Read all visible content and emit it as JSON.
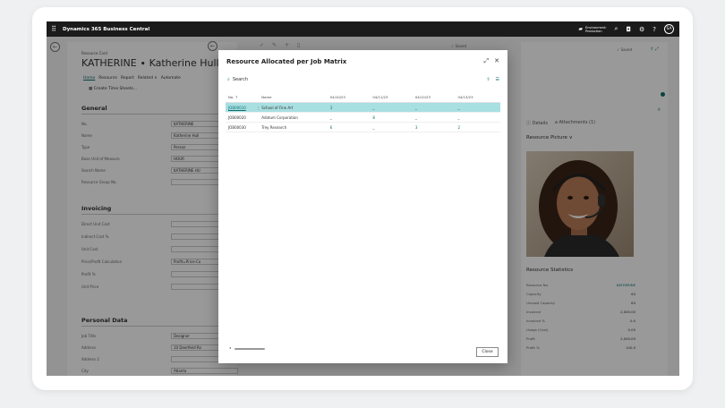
{
  "app": {
    "title": "Dynamics 365 Business Central",
    "environment_line1": "Environment:",
    "environment_line2": "Production",
    "avatar_initials": "SA"
  },
  "resource_card": {
    "breadcrumb": "Resource Card",
    "title": "KATHERINE ∙ Katherine Hull",
    "actions": [
      "Home",
      "Resource",
      "Report",
      "Related ∨",
      "Automate"
    ],
    "create_time_sheets": "Create Time Sheets...",
    "sections": {
      "general": "General",
      "invoicing": "Invoicing",
      "personal_data": "Personal Data"
    },
    "general_fields": [
      {
        "label": "No.",
        "value": "KATHERINE"
      },
      {
        "label": "Name",
        "value": "Katherine Hull"
      },
      {
        "label": "Type",
        "value": "Person"
      },
      {
        "label": "Base Unit of Measure",
        "value": "HOUR"
      },
      {
        "label": "Search Name",
        "value": "KATHERINE HU"
      },
      {
        "label": "Resource Group No.",
        "value": ""
      }
    ],
    "invoicing_fields": [
      {
        "label": "Direct Unit Cost",
        "value": ""
      },
      {
        "label": "Indirect Cost %",
        "value": ""
      },
      {
        "label": "Unit Cost",
        "value": ""
      },
      {
        "label": "Price/Profit Calculation",
        "value": "Profit=Price-Co"
      },
      {
        "label": "Profit %",
        "value": ""
      },
      {
        "label": "Unit Price",
        "value": ""
      }
    ],
    "personal_fields": [
      {
        "label": "Job Title",
        "value": "Designer"
      },
      {
        "label": "Address",
        "value": "10 Deerfield Ro"
      },
      {
        "label": "Address 2",
        "value": ""
      },
      {
        "label": "City",
        "value": "Atlanta"
      }
    ]
  },
  "factbox": {
    "saved": "✓ Saved",
    "tabs": [
      "Details",
      "Attachments (1)"
    ],
    "picture_title": "Resource Picture ∨",
    "stats_title": "Resource Statistics",
    "stats": [
      {
        "label": "Resource No.",
        "value": "KATHERINE",
        "link": true
      },
      {
        "label": "Capacity",
        "value": "64"
      },
      {
        "label": "Unused Capacity",
        "value": "64"
      },
      {
        "label": "Invoiced",
        "value": "2,000.00"
      },
      {
        "label": "Invoiced %",
        "value": "0.0"
      },
      {
        "label": "Usage (Cost)",
        "value": "0.00"
      },
      {
        "label": "Profit",
        "value": "2,000.00"
      },
      {
        "label": "Profit %",
        "value": "100.0"
      }
    ]
  },
  "dialog": {
    "title": "Resource Allocated per Job Matrix",
    "search_label": "Search",
    "columns": {
      "no": "No. ↑",
      "name": "Name",
      "periods": [
        "04/10/23",
        "04/11/23",
        "04/12/23",
        "04/13/23"
      ]
    },
    "rows": [
      {
        "no": "JOB00010",
        "name": "School of Fine Art",
        "values": [
          "3",
          "_",
          "_",
          "_"
        ],
        "selected": true
      },
      {
        "no": "JOB00020",
        "name": "Adatum Corporation",
        "values": [
          "_",
          "8",
          "_",
          "_"
        ],
        "selected": false
      },
      {
        "no": "JOB00030",
        "name": "Trey Research",
        "values": [
          "6",
          "_",
          "3",
          "2"
        ],
        "selected": false
      }
    ],
    "close_label": "Close"
  }
}
